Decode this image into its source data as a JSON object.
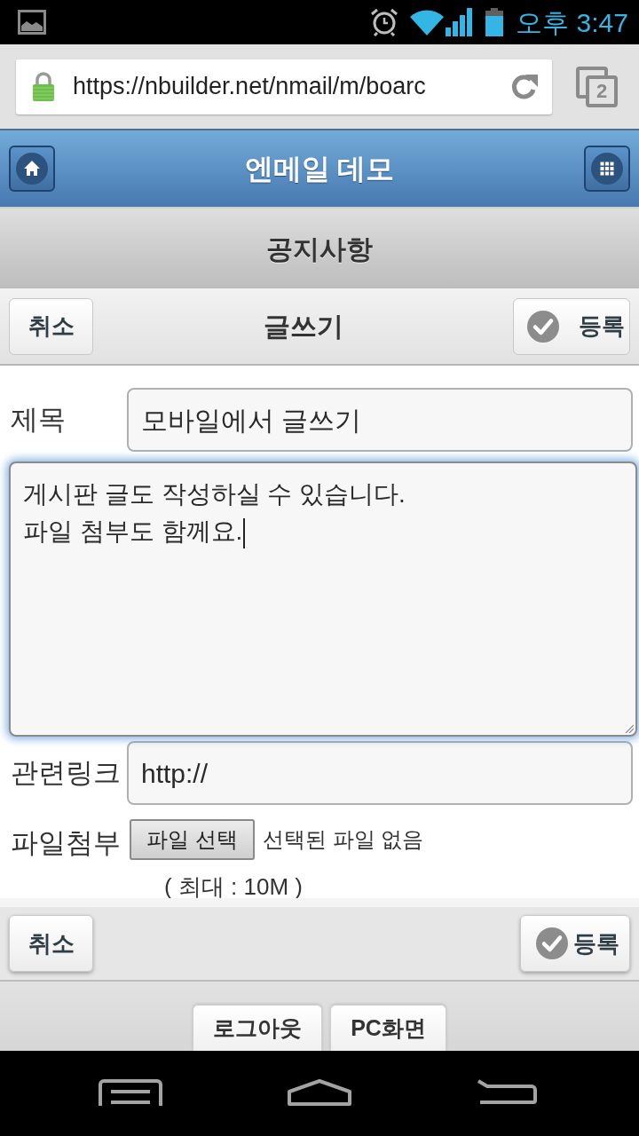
{
  "status_bar": {
    "time": "오후 3:47"
  },
  "browser": {
    "url": "https://nbuilder.net/nmail/m/boarc",
    "tab_count": "2"
  },
  "header": {
    "title": "엔메일 데모"
  },
  "subheader": {
    "title": "공지사항"
  },
  "toolbar": {
    "title": "글쓰기",
    "buttons": [
      {
        "label": "취소",
        "kind": "plain"
      },
      {
        "label": "등록",
        "kind": "check"
      }
    ]
  },
  "form": {
    "fields": [
      {
        "kind": "input",
        "label": "제목",
        "value": "모바일에서 글쓰기"
      },
      {
        "kind": "textarea",
        "lines": [
          "게시판 글도 작성하실 수 있습니다.",
          "파일 첨부도 함께요."
        ],
        "focused": true
      },
      {
        "kind": "input",
        "label": "관련링크",
        "value": "http://"
      },
      {
        "kind": "file",
        "label": "파일첨부",
        "button": "파일 선택",
        "status": "선택된 파일 없음",
        "note": "( 최대 : 10M )"
      }
    ]
  },
  "footer_toolbar": {
    "buttons": [
      {
        "label": "취소",
        "kind": "plain"
      },
      {
        "label": "등록",
        "kind": "check"
      }
    ]
  },
  "footer_links": [
    "로그아웃",
    "PC화면"
  ]
}
